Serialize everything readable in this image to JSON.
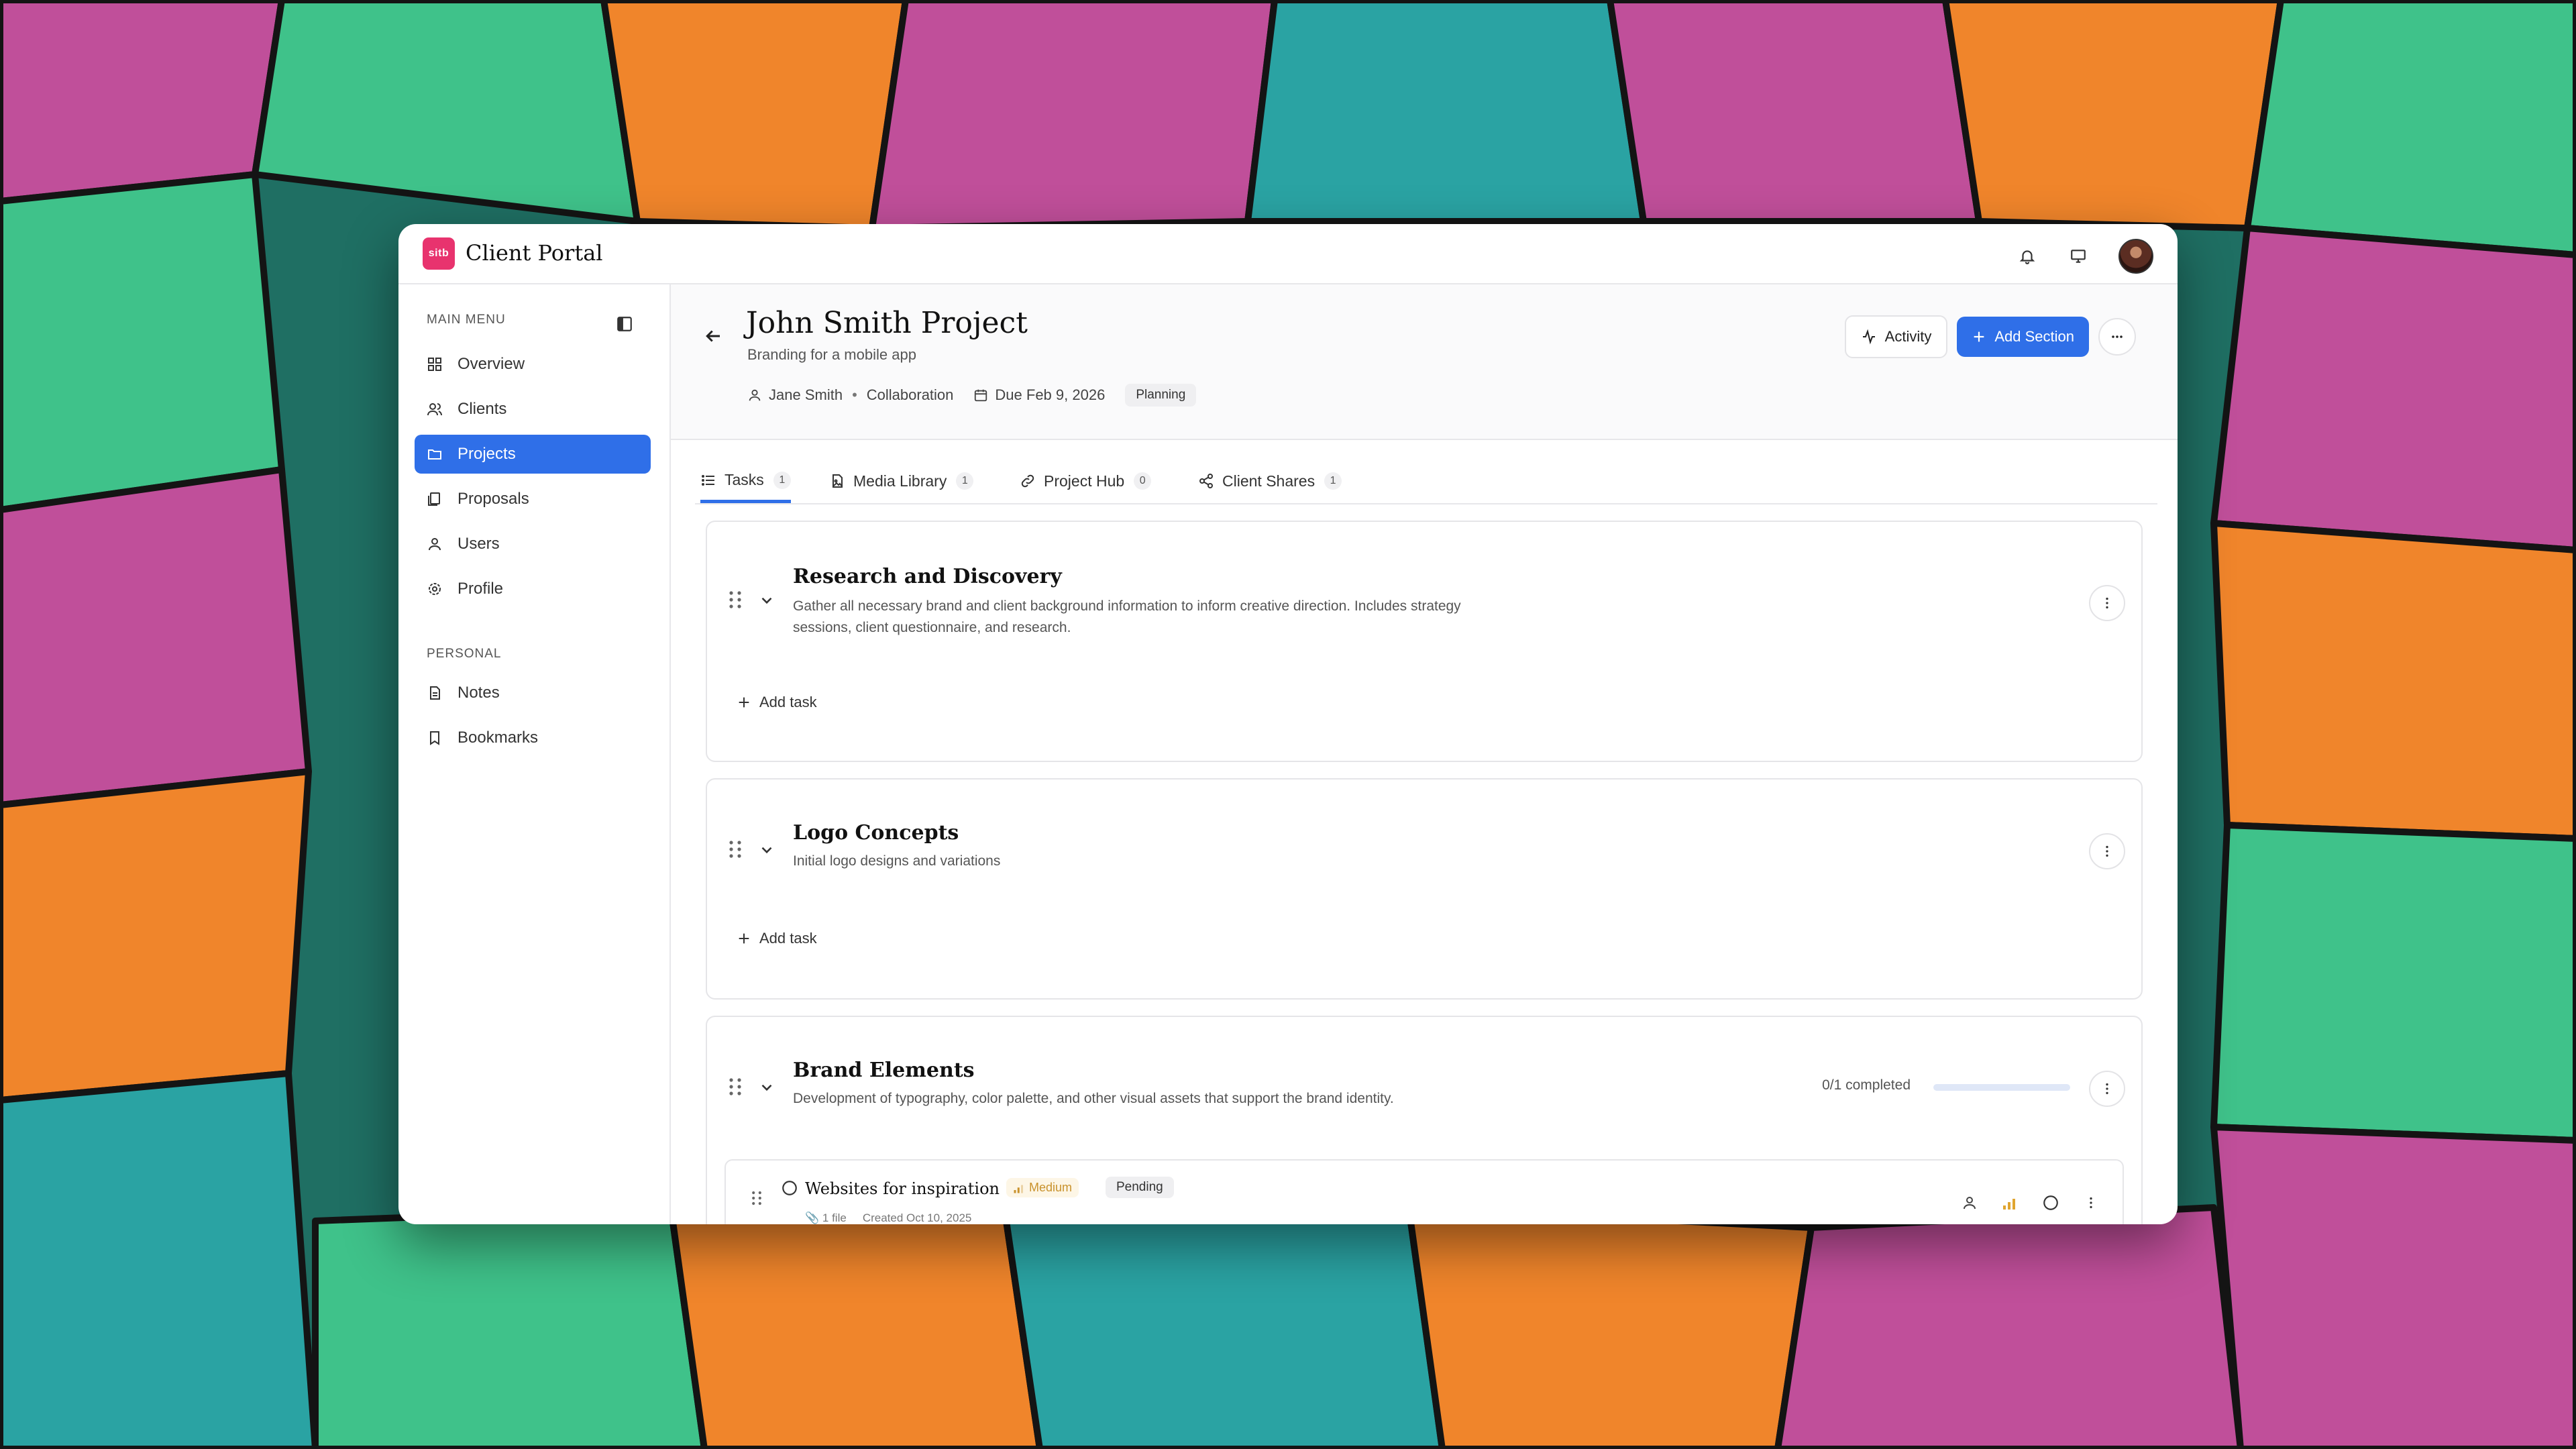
{
  "app": {
    "logo_text": "sitb",
    "title": "Client Portal"
  },
  "sidebar": {
    "main_heading": "MAIN MENU",
    "items": [
      {
        "label": "Overview",
        "icon": "grid-icon"
      },
      {
        "label": "Clients",
        "icon": "users-icon"
      },
      {
        "label": "Projects",
        "icon": "folder-icon",
        "active": true
      },
      {
        "label": "Proposals",
        "icon": "proposal-icon"
      },
      {
        "label": "Users",
        "icon": "user-icon"
      },
      {
        "label": "Profile",
        "icon": "gear-icon"
      }
    ],
    "personal_heading": "PERSONAL",
    "personal_items": [
      {
        "label": "Notes",
        "icon": "note-icon"
      },
      {
        "label": "Bookmarks",
        "icon": "bookmark-icon"
      }
    ]
  },
  "project": {
    "title": "John Smith Project",
    "subtitle": "Branding for a mobile app",
    "owner": "Jane Smith",
    "type": "Collaboration",
    "due": "Due Feb 9, 2026",
    "status": "Planning",
    "actions": {
      "activity": "Activity",
      "add_section": "Add Section"
    }
  },
  "tabs": [
    {
      "label": "Tasks",
      "count": "1",
      "active": true
    },
    {
      "label": "Media Library",
      "count": "1"
    },
    {
      "label": "Project Hub",
      "count": "0"
    },
    {
      "label": "Client Shares",
      "count": "1"
    }
  ],
  "sections": [
    {
      "title": "Research and Discovery",
      "desc": "Gather all necessary brand and client background information to inform creative direction. Includes strategy sessions, client questionnaire, and research.",
      "add_task": "Add task"
    },
    {
      "title": "Logo Concepts",
      "desc": "Initial logo designs and variations",
      "add_task": "Add task"
    },
    {
      "title": "Brand Elements",
      "desc": "Development of typography, color palette, and other visual assets that support the brand identity.",
      "progress_text": "0/1 completed",
      "progress_fraction": 0,
      "task": {
        "name": "Websites for inspiration",
        "priority": "Medium",
        "status": "Pending",
        "files": "1 file",
        "created": "Created Oct 10, 2025"
      }
    }
  ],
  "colors": {
    "accent": "#2f6fe8",
    "logo": "#e8336e",
    "priority": "#c9922c"
  }
}
